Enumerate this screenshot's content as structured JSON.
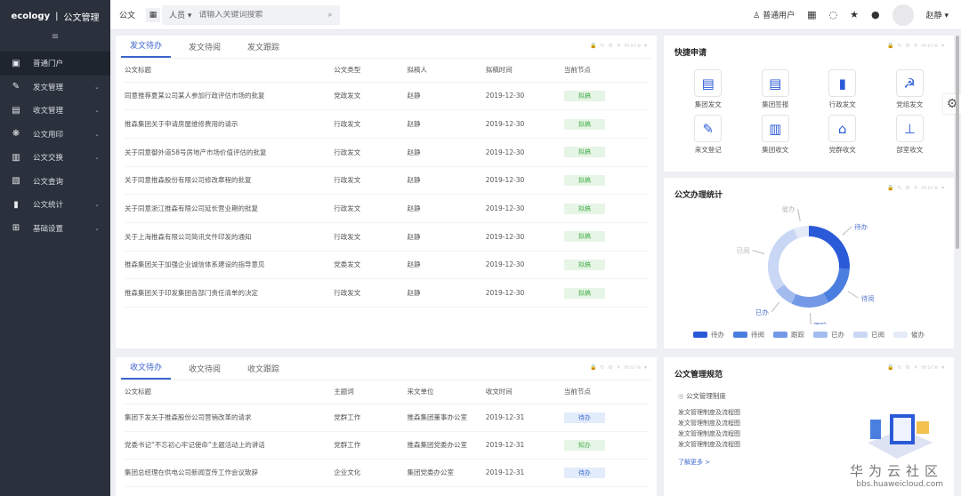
{
  "sidebar": {
    "brand": "ecology",
    "separator": "|",
    "module": "公文管理",
    "collapse_icon": "≡",
    "items": [
      {
        "label": "普通门户",
        "icon": "portal-icon",
        "active": true
      },
      {
        "label": "发文管理",
        "icon": "edit-doc-icon"
      },
      {
        "label": "收文管理",
        "icon": "inbox-doc-icon"
      },
      {
        "label": "公文用印",
        "icon": "seal-icon"
      },
      {
        "label": "公文交换",
        "icon": "exchange-icon"
      },
      {
        "label": "公文查询",
        "icon": "query-icon"
      },
      {
        "label": "公文统计",
        "icon": "chart-icon"
      },
      {
        "label": "基础设置",
        "icon": "settings-grid-icon"
      }
    ]
  },
  "topbar": {
    "title": "公文",
    "search_scope": "人员",
    "search_placeholder": "请输入关键词搜索",
    "user_role": "普通用户",
    "user_name": "赵静"
  },
  "outgoing": {
    "tabs": [
      "发文待办",
      "发文待阅",
      "发文跟踪"
    ],
    "active_tab": 0,
    "columns": [
      "公文标题",
      "公文类型",
      "拟稿人",
      "拟稿时间",
      "当前节点"
    ],
    "rows": [
      [
        "同意推荐夏某公司某人参加行政评估市场的批复",
        "党政发文",
        "赵静",
        "2019-12-30",
        "拟稿"
      ],
      [
        "推森集团关于申请房屋维修费用的请示",
        "行政发文",
        "赵静",
        "2019-12-30",
        "拟稿"
      ],
      [
        "关于同意御外道58号房地产市场价值评估的批复",
        "行政发文",
        "赵静",
        "2019-12-30",
        "拟稿"
      ],
      [
        "关于同意推森股份有限公司修改章程的批复",
        "行政发文",
        "赵静",
        "2019-12-30",
        "拟稿"
      ],
      [
        "关于同意浙江推森有限公司延长营业期的批复",
        "行政发文",
        "赵静",
        "2019-12-30",
        "拟稿"
      ],
      [
        "关于上海推森有限公司简讯文件印发的通知",
        "行政发文",
        "赵静",
        "2019-12-30",
        "拟稿"
      ],
      [
        "推森集团关于加强企业诚信体系建设的指导意见",
        "党委发文",
        "赵静",
        "2019-12-30",
        "拟稿"
      ],
      [
        "推森集团关于印发集团各部门责任清单的决定",
        "行政发文",
        "赵静",
        "2019-12-30",
        "拟稿"
      ]
    ]
  },
  "incoming": {
    "tabs": [
      "收文待办",
      "收文待阅",
      "收文跟踪"
    ],
    "active_tab": 0,
    "columns": [
      "公文标题",
      "主题词",
      "来文单位",
      "收文时间",
      "当前节点"
    ],
    "rows": [
      [
        "集团下发关于推森股份公司营销改革的请求",
        "党群工作",
        "推森集团董事办公室",
        "2019-12-31",
        "待办",
        "blue"
      ],
      [
        "党委书记“不忘初心牢记使命”主题活动上的讲话",
        "党群工作",
        "推森集团党委办公室",
        "2019-12-31",
        "知办",
        "green"
      ],
      [
        "集团总经理在供电公司新闻宣传工作会议致辞",
        "企业文化",
        "集团党委办公室",
        "2019-12-31",
        "待办",
        "blue"
      ]
    ]
  },
  "quick": {
    "title": "快捷申请",
    "items": [
      {
        "label": "集团发文",
        "icon": "doc-send-icon",
        "glyph": "▤"
      },
      {
        "label": "集团签报",
        "icon": "doc-sign-icon",
        "glyph": "▤"
      },
      {
        "label": "行政发文",
        "icon": "file-icon",
        "glyph": "▮"
      },
      {
        "label": "党组发文",
        "icon": "party-emblem-icon",
        "glyph": "☭"
      },
      {
        "label": "来文登记",
        "icon": "register-icon",
        "glyph": "✎"
      },
      {
        "label": "集团收文",
        "icon": "building-icon",
        "glyph": "▥"
      },
      {
        "label": "党群收文",
        "icon": "institution-icon",
        "glyph": "⌂"
      },
      {
        "label": "部室收文",
        "icon": "org-chart-icon",
        "glyph": "⊥"
      }
    ]
  },
  "stats": {
    "title": "公文办理统计"
  },
  "chart_data": {
    "type": "pie",
    "variant": "donut",
    "title": "公文办理统计",
    "categories": [
      "待办",
      "待阅",
      "跟踪",
      "已办",
      "已阅",
      "催办"
    ],
    "values": [
      26,
      16,
      15,
      8,
      29,
      6
    ],
    "colors": [
      "#2a5ad8",
      "#4a7fe0",
      "#7399e6",
      "#a3bbef",
      "#c9d7f5",
      "#e4eaf7"
    ],
    "legend": "bottom"
  },
  "norms": {
    "title": "公文管理规范",
    "category": "公文管理制度",
    "items": [
      "发文管理制度及流程图",
      "发文管理制度及流程图",
      "发文管理制度及流程图",
      "发文管理制度及流程图"
    ],
    "more": "了解更多 >"
  },
  "watermark": {
    "line1": "华为云社区",
    "line2": "bbs.huaweicloud.com"
  }
}
